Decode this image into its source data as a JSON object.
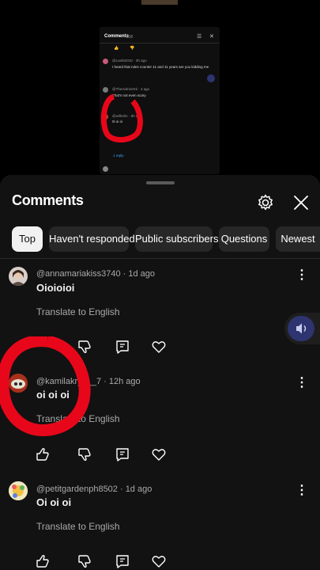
{
  "preview": {
    "title": "Comments",
    "count": "238",
    "comments": [
      {
        "author": "@Lamb2010 · 3h ago",
        "text": "I heard that rules counter 11 and 11 years are you kidding me"
      },
      {
        "author": "@TheAdmin3Hi · 4 ago",
        "text": "That's not even scary"
      },
      {
        "author": "@wilhelm · 6h ago",
        "text": "0i oi oi"
      }
    ],
    "reply_label": "1 reply"
  },
  "sheet": {
    "title": "Comments",
    "gear_icon": "gear-icon",
    "close_icon": "close-icon"
  },
  "filters": [
    {
      "label": "Top",
      "active": true
    },
    {
      "label": "Haven't responded",
      "active": false
    },
    {
      "label": "Public subscribers",
      "active": false
    },
    {
      "label": "Questions",
      "active": false
    },
    {
      "label": "Newest",
      "active": false
    }
  ],
  "comments": [
    {
      "author": "@annamariakiss3740 · 1d ago",
      "text": "Oioioioi",
      "translate": "Translate to English"
    },
    {
      "author": "@kamilakry___7 · 12h ago",
      "text": "oi oi oi",
      "translate": "Translate to English"
    },
    {
      "author": "@petitgardenph8502 · 1d ago",
      "text": "Oi oi oi",
      "translate": "Translate to English"
    }
  ],
  "colors": {
    "accent_chip": "#f1f1f1",
    "annotation_red": "#e8071a",
    "float_button": "#2d3470"
  }
}
